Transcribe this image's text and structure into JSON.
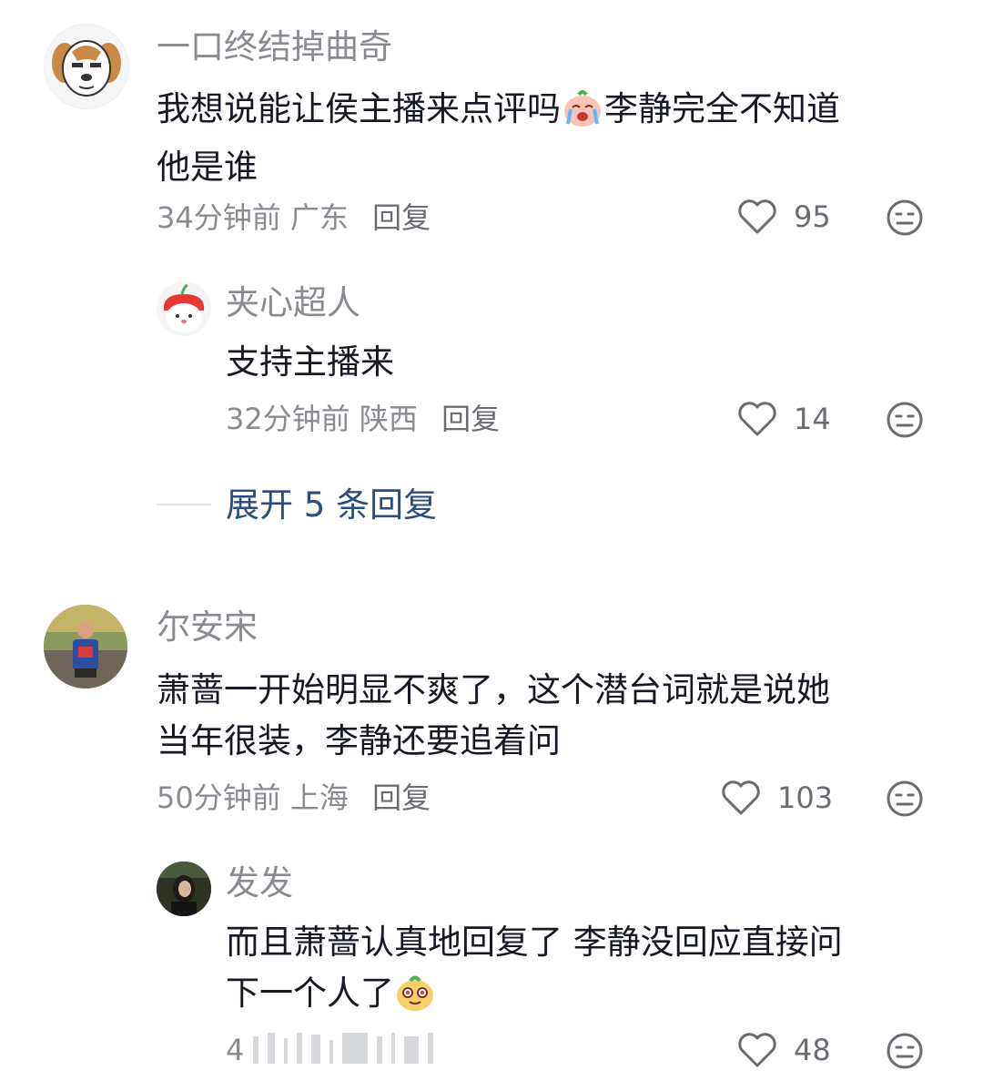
{
  "comments": [
    {
      "user": "一口终结掉曲奇",
      "text_a": "我想说能让侯主播来点评吗",
      "text_b": "李静完全不知道",
      "text_c": "他是谁",
      "time": "34分钟前",
      "region": "广东",
      "reply": "回复",
      "likes": "95",
      "replies": [
        {
          "user": "夹心超人",
          "text": "支持主播来",
          "time": "32分钟前",
          "region": "陕西",
          "reply": "回复",
          "likes": "14"
        }
      ],
      "expand": "展开 5 条回复"
    },
    {
      "user": "尔安宋",
      "text_a": "萧蔷一开始明显不爽了，这个潜台词就是说她",
      "text_b": "当年很装，李静还要追着问",
      "time": "50分钟前",
      "region": "上海",
      "reply": "回复",
      "likes": "103",
      "replies": [
        {
          "user": "发发",
          "text_a": "而且萧蔷认真地回复了 李静没回应直接问",
          "text_b": "下一个人了",
          "time_partial": "4",
          "likes": "48"
        }
      ]
    }
  ],
  "icons": {
    "like": "heart-outline-icon",
    "dislike": "meh-face-icon",
    "emoji_cry": "crying-peach-emoji",
    "emoji_sly": "sly-face-emoji"
  },
  "colors": {
    "text": "#161823",
    "muted": "#8a8b91",
    "link": "#2b4d7e",
    "divider": "#e3e3e6"
  }
}
